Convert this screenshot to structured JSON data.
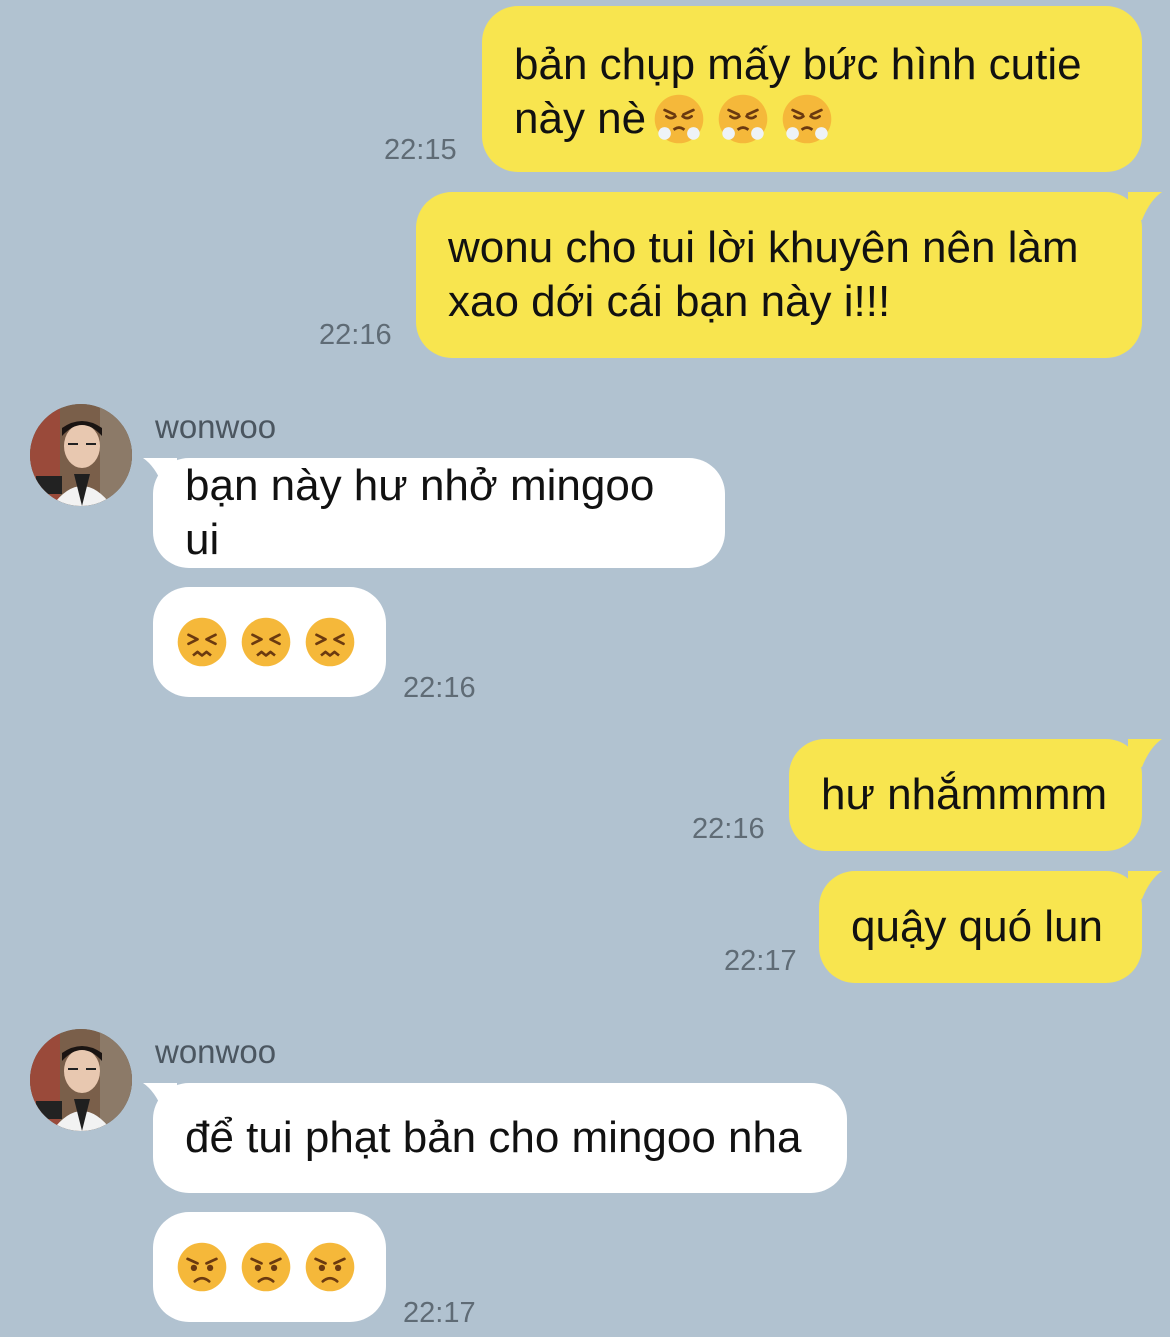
{
  "conversation": {
    "contact_name": "wonwoo",
    "messages": [
      {
        "id": "m1",
        "sender": "me",
        "text_line1": "bản chụp mấy bức hình cutie",
        "text_line2": "này nè",
        "emojis": [
          "huffing-face",
          "huffing-face",
          "huffing-face"
        ],
        "time": "22:15"
      },
      {
        "id": "m2",
        "sender": "me",
        "text": "wonu cho tui lời khuyên nên làm\nxao dới cái bạn này i!!!",
        "time": "22:16"
      },
      {
        "id": "m3",
        "sender": "wonwoo",
        "text": "bạn này hư nhở mingoo ui"
      },
      {
        "id": "m4",
        "sender": "wonwoo",
        "emojis": [
          "persevering-face",
          "persevering-face",
          "persevering-face"
        ],
        "time": "22:16"
      },
      {
        "id": "m5",
        "sender": "me",
        "text": "hư nhắmmmm",
        "time": "22:16"
      },
      {
        "id": "m6",
        "sender": "me",
        "text": "quậy quó lun",
        "time": "22:17"
      },
      {
        "id": "m7",
        "sender": "wonwoo",
        "text": "để tui phạt bản cho mingoo nha"
      },
      {
        "id": "m8",
        "sender": "wonwoo",
        "emojis": [
          "angry-face",
          "angry-face",
          "angry-face"
        ],
        "time": "22:17"
      }
    ]
  },
  "colors": {
    "background": "#b1c2d0",
    "outgoing_bubble": "#f8e54f",
    "incoming_bubble": "#ffffff",
    "timestamp": "#5f6b75"
  }
}
